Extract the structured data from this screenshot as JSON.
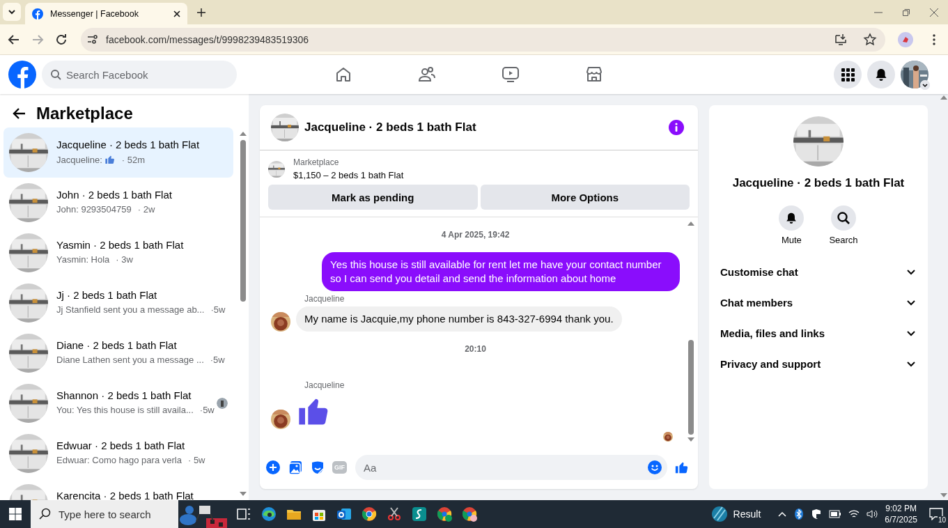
{
  "browser": {
    "tab_title": "Messenger | Facebook",
    "url": "facebook.com/messages/t/9998239483519306"
  },
  "header": {
    "search_placeholder": "Search Facebook"
  },
  "sidebar": {
    "title": "Marketplace",
    "conversations": [
      {
        "title": "Jacqueline · 2 beds 1 bath Flat",
        "preview": "Jacqueline:",
        "time": "· 52m",
        "kind": "like",
        "selected": true,
        "seen": false
      },
      {
        "title": "John · 2 beds 1 bath Flat",
        "preview": "John: 9293504759",
        "time": "· 2w",
        "kind": "text",
        "selected": false,
        "seen": false
      },
      {
        "title": "Yasmin · 2 beds 1 bath Flat",
        "preview": "Yasmin: Hola",
        "time": "· 3w",
        "kind": "text",
        "selected": false,
        "seen": false
      },
      {
        "title": "Jj · 2 beds 1 bath Flat",
        "preview": "Jj Stanfield sent you a message ab...",
        "time": "·5w",
        "kind": "text",
        "selected": false,
        "seen": false
      },
      {
        "title": "Diane · 2 beds 1 bath Flat",
        "preview": "Diane Lathen sent you a message ...",
        "time": "·5w",
        "kind": "text",
        "selected": false,
        "seen": false
      },
      {
        "title": "Shannon · 2 beds 1 bath Flat",
        "preview": "You: Yes this house is still availa...",
        "time": "·5w",
        "kind": "text",
        "selected": false,
        "seen": true
      },
      {
        "title": "Edwuar · 2 beds 1 bath Flat",
        "preview": "Edwuar: Como hago para verla",
        "time": "· 5w",
        "kind": "text",
        "selected": false,
        "seen": false
      },
      {
        "title": "Karencita · 2 beds 1 bath Flat",
        "kind": "text",
        "selected": false,
        "seen": false
      }
    ]
  },
  "chat": {
    "title": "Jacqueline · 2 beds 1 bath Flat",
    "listing": {
      "label": "Marketplace",
      "summary": "$1,150 – 2 beds 1 bath Flat"
    },
    "actions": [
      "Mark as pending",
      "More Options"
    ],
    "messages": [
      {
        "kind": "timestamp",
        "text": "4 Apr 2025, 19:42"
      },
      {
        "kind": "outgoing",
        "text": "Yes this house is still available for rent let me have your contact number so I can send you detail and send the information about home"
      },
      {
        "kind": "incoming",
        "sender": "Jacqueline",
        "text": "My name is Jacquie,my phone number is 843-327-6994 thank you."
      },
      {
        "kind": "timestamp",
        "text": "20:10"
      },
      {
        "kind": "like",
        "sender": "Jacqueline"
      }
    ],
    "composer": {
      "gif_label": "GIF",
      "placeholder": "Aa"
    }
  },
  "info": {
    "name": "Jacqueline · 2 beds 1 bath Flat",
    "actions": [
      {
        "kind": "bell",
        "label": "Mute"
      },
      {
        "kind": "search",
        "label": "Search"
      }
    ],
    "sections": [
      "Customise chat",
      "Chat members",
      "Media, files and links",
      "Privacy and support"
    ]
  },
  "taskbar": {
    "search_placeholder": "Type here to search",
    "weather": "Result",
    "time": "9:02 PM",
    "date": "6/7/2025",
    "notifications": "10"
  }
}
